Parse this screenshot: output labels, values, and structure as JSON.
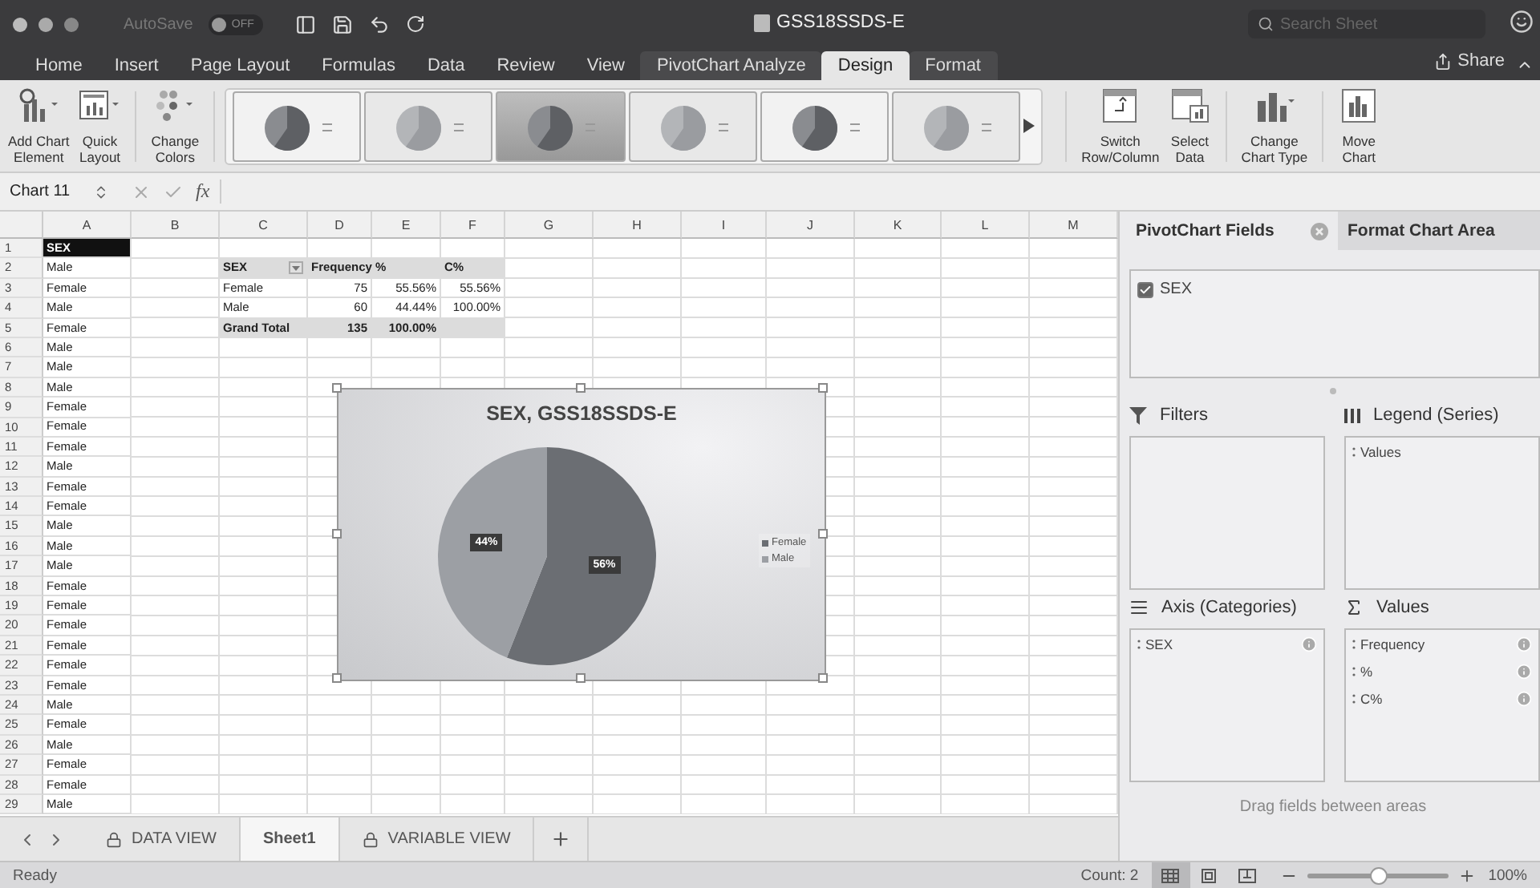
{
  "window": {
    "title": "GSS18SSDS-E",
    "autosave_label": "AutoSave",
    "autosave_state": "OFF",
    "search_placeholder": "Search Sheet",
    "share_label": "Share"
  },
  "ribbon_tabs": [
    {
      "label": "Home",
      "selected": false
    },
    {
      "label": "Insert",
      "selected": false
    },
    {
      "label": "Page Layout",
      "selected": false
    },
    {
      "label": "Formulas",
      "selected": false
    },
    {
      "label": "Data",
      "selected": false
    },
    {
      "label": "Review",
      "selected": false
    },
    {
      "label": "View",
      "selected": false
    },
    {
      "label": "PivotChart Analyze",
      "selected": false
    },
    {
      "label": "Design",
      "selected": true
    },
    {
      "label": "Format",
      "selected": false
    }
  ],
  "ribbon_left": [
    {
      "kind": "add-element",
      "lines": [
        "Add Chart",
        "Element"
      ]
    },
    {
      "kind": "quick-layout",
      "lines": [
        "Quick",
        "Layout"
      ]
    },
    {
      "kind": "change-colors",
      "lines": [
        "Change",
        "Colors"
      ]
    }
  ],
  "chart_styles": [
    {
      "kind": "dark"
    },
    {
      "kind": "light"
    },
    {
      "kind": "labeled"
    },
    {
      "kind": "light"
    },
    {
      "kind": "dark"
    },
    {
      "kind": "light"
    }
  ],
  "ribbon_right": [
    {
      "kind": "switch",
      "lines": [
        "Switch",
        "Row/Column"
      ]
    },
    {
      "kind": "select-data",
      "lines": [
        "Select",
        "Data"
      ]
    },
    {
      "kind": "chart-type",
      "lines": [
        "Change",
        "Chart Type"
      ]
    },
    {
      "kind": "move-chart",
      "lines": [
        "Move",
        "Chart"
      ]
    }
  ],
  "formula_bar": {
    "name_box": "Chart 11",
    "fx": "fx"
  },
  "sheet": {
    "columns": [
      "A",
      "B",
      "C",
      "D",
      "E",
      "F",
      "G",
      "H",
      "I",
      "J",
      "K",
      "L",
      "M"
    ],
    "row_numbers": [
      "1",
      "2",
      "3",
      "4",
      "5",
      "6",
      "7",
      "8",
      "9",
      "10",
      "11",
      "12",
      "13",
      "14",
      "15",
      "16",
      "17",
      "18",
      "19",
      "20",
      "21",
      "22",
      "23",
      "24",
      "25",
      "26",
      "27",
      "28",
      "29"
    ],
    "column_a": [
      {
        "text": "SEX",
        "selected": true
      },
      {
        "text": "Male",
        "selected": false
      },
      {
        "text": "Female",
        "selected": false
      },
      {
        "text": "Male",
        "selected": false
      },
      {
        "text": "Female",
        "selected": false
      },
      {
        "text": "Male",
        "selected": false
      },
      {
        "text": "Male",
        "selected": false
      },
      {
        "text": "Male",
        "selected": false
      },
      {
        "text": "Female",
        "selected": false
      },
      {
        "text": "Female",
        "selected": false
      },
      {
        "text": "Female",
        "selected": false
      },
      {
        "text": "Male",
        "selected": false
      },
      {
        "text": "Female",
        "selected": false
      },
      {
        "text": "Female",
        "selected": false
      },
      {
        "text": "Male",
        "selected": false
      },
      {
        "text": "Male",
        "selected": false
      },
      {
        "text": "Male",
        "selected": false
      },
      {
        "text": "Female",
        "selected": false
      },
      {
        "text": "Female",
        "selected": false
      },
      {
        "text": "Female",
        "selected": false
      },
      {
        "text": "Female",
        "selected": false
      },
      {
        "text": "Female",
        "selected": false
      },
      {
        "text": "Female",
        "selected": false
      },
      {
        "text": "Male",
        "selected": false
      },
      {
        "text": "Female",
        "selected": false
      },
      {
        "text": "Male",
        "selected": false
      },
      {
        "text": "Female",
        "selected": false
      },
      {
        "text": "Female",
        "selected": false
      },
      {
        "text": "Male",
        "selected": false
      }
    ]
  },
  "pivot_table": [
    {
      "kind": "header",
      "cells": [
        "SEX",
        "Frequency",
        "%",
        "C%"
      ]
    },
    {
      "kind": "item",
      "cells": [
        "Female",
        "75",
        "55.56%",
        "55.56%"
      ]
    },
    {
      "kind": "item",
      "cells": [
        "Male",
        "60",
        "44.44%",
        "100.00%"
      ]
    },
    {
      "kind": "total",
      "cells": [
        "Grand Total",
        "135",
        "100.00%"
      ]
    }
  ],
  "chart": {
    "chart_data": {
      "type": "pie",
      "title": "SEX, GSS18SSDS-E",
      "categories": [
        "Female",
        "Male"
      ],
      "values": [
        56,
        44
      ],
      "colors": [
        "#6b6e73",
        "#9c9fa4"
      ],
      "value_labels": [
        "56%",
        "44%"
      ],
      "legend": "right"
    }
  },
  "sheet_tabs": [
    {
      "label": "DATA VIEW",
      "locked": true,
      "selected": false
    },
    {
      "label": "Sheet1",
      "locked": false,
      "selected": true
    },
    {
      "label": "VARIABLE VIEW",
      "locked": true,
      "selected": false
    }
  ],
  "pivot_pane": {
    "tabs": [
      {
        "label": "PivotChart Fields",
        "selected": true
      },
      {
        "label": "Format Chart Area",
        "selected": false
      }
    ],
    "fields": [
      {
        "label": "SEX",
        "checked": true
      }
    ],
    "areas": [
      {
        "kind": "filters",
        "title": "Filters"
      },
      {
        "kind": "legend",
        "title": "Legend (Series)",
        "items": [
          {
            "label": "Values",
            "info": false
          }
        ]
      },
      {
        "kind": "axis",
        "title": "Axis (Categories)",
        "items": [
          {
            "label": "SEX",
            "info": true
          }
        ]
      },
      {
        "kind": "values",
        "title": "Values",
        "items": [
          {
            "label": "Frequency",
            "info": true
          },
          {
            "label": "%",
            "info": true
          },
          {
            "label": "C%",
            "info": true
          }
        ]
      }
    ],
    "hint": "Drag fields between areas"
  },
  "status_bar": {
    "status": "Ready",
    "count": "Count: 2",
    "views": [
      {
        "kind": "normal",
        "selected": true
      },
      {
        "kind": "page-layout",
        "selected": false
      },
      {
        "kind": "page-break",
        "selected": false
      }
    ],
    "zoom": {
      "level": 0.5,
      "reading": "100%"
    }
  }
}
